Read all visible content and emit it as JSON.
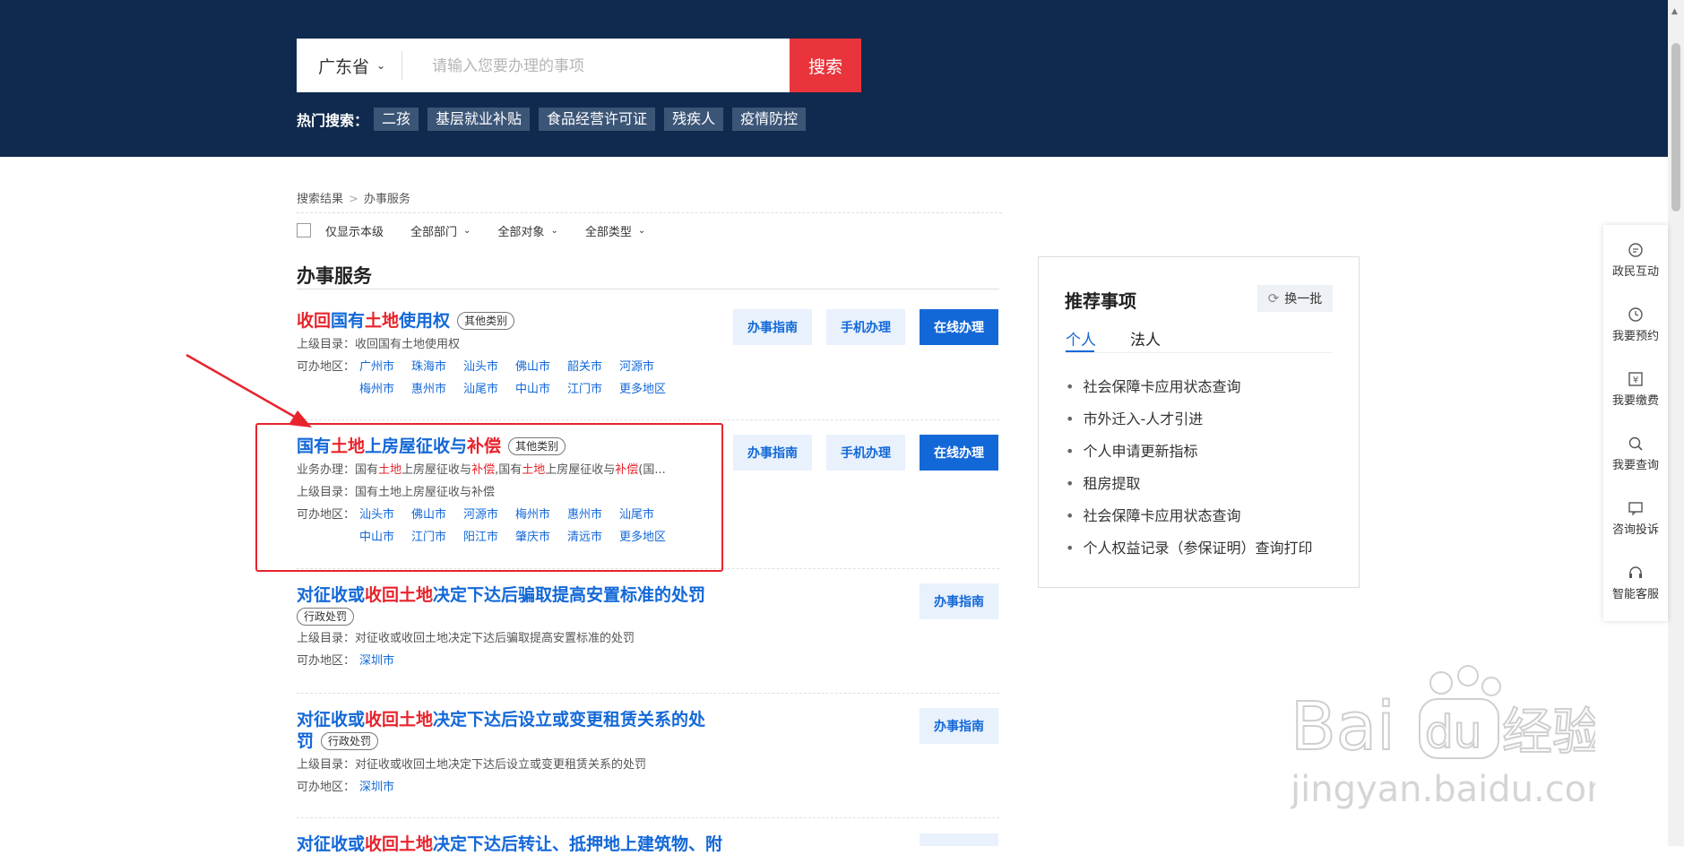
{
  "header": {
    "region": "广东省",
    "search_placeholder": "请输入您要办理的事项",
    "search_button": "搜索",
    "hot_label": "热门搜索：",
    "hot_tags": [
      "二孩",
      "基层就业补贴",
      "食品经营许可证",
      "残疾人",
      "疫情防控"
    ]
  },
  "breadcrumb": [
    "搜索结果",
    "办事服务"
  ],
  "breadcrumb_sep": ">",
  "filters": {
    "only_local": "仅显示本级",
    "department": "全部部门",
    "target": "全部对象",
    "type": "全部类型"
  },
  "section_title": "办事服务",
  "labels": {
    "parent": "上级目录：",
    "areas": "可办地区：",
    "business": "业务办理："
  },
  "buttons": {
    "guide": "办事指南",
    "mobile": "手机办理",
    "online": "在线办理"
  },
  "results": [
    {
      "title_parts": [
        {
          "t": "收回",
          "hl": true
        },
        {
          "t": "国有",
          "hl": false
        },
        {
          "t": "土地",
          "hl": true
        },
        {
          "t": "使用权",
          "hl": false
        }
      ],
      "badge": "其他类别",
      "parent": "收回国有土地使用权",
      "areas": [
        "广州市",
        "珠海市",
        "汕头市",
        "佛山市",
        "韶关市",
        "河源市",
        "梅州市",
        "惠州市",
        "汕尾市",
        "中山市",
        "江门市",
        "更多地区"
      ]
    },
    {
      "title_parts": [
        {
          "t": "国有",
          "hl": false
        },
        {
          "t": "土地",
          "hl": true
        },
        {
          "t": "上房屋征收与",
          "hl": false
        },
        {
          "t": "补偿",
          "hl": true
        }
      ],
      "badge": "其他类别",
      "business_parts": [
        {
          "t": "国有",
          "hl": false
        },
        {
          "t": "土地",
          "hl": true
        },
        {
          "t": "上房屋征收与",
          "hl": false
        },
        {
          "t": "补偿",
          "hl": true
        },
        {
          "t": ",国有",
          "hl": false
        },
        {
          "t": "土地",
          "hl": true
        },
        {
          "t": "上房屋征收与",
          "hl": false
        },
        {
          "t": "补偿",
          "hl": true
        },
        {
          "t": "(国...",
          "hl": false
        }
      ],
      "parent": "国有土地上房屋征收与补偿",
      "areas": [
        "汕头市",
        "佛山市",
        "河源市",
        "梅州市",
        "惠州市",
        "汕尾市",
        "中山市",
        "江门市",
        "阳江市",
        "肇庆市",
        "清远市",
        "更多地区"
      ]
    },
    {
      "title_parts": [
        {
          "t": "对征收或",
          "hl": false
        },
        {
          "t": "收回",
          "hl": true
        },
        {
          "t": "土地",
          "hl": true
        },
        {
          "t": "决定下达后骗取提高安置标准的处罚",
          "hl": false
        }
      ],
      "badge": "行政处罚",
      "parent": "对征收或收回土地决定下达后骗取提高安置标准的处罚",
      "areas": [
        "深圳市"
      ]
    },
    {
      "title_parts": [
        {
          "t": "对征收或",
          "hl": false
        },
        {
          "t": "收回",
          "hl": true
        },
        {
          "t": "土地",
          "hl": true
        },
        {
          "t": "决定下达后设立或变更租赁关系的处",
          "hl": false
        }
      ],
      "title_line2": "罚",
      "badge": "行政处罚",
      "parent": "对征收或收回土地决定下达后设立或变更租赁关系的处罚",
      "areas": [
        "深圳市"
      ]
    },
    {
      "title_parts": [
        {
          "t": "对征收或",
          "hl": false
        },
        {
          "t": "收回",
          "hl": true
        },
        {
          "t": "土地",
          "hl": true
        },
        {
          "t": "决定下达后转让、抵押地上建筑物、附",
          "hl": false
        }
      ]
    }
  ],
  "recommend": {
    "title": "推荐事项",
    "refresh": "换一批",
    "tabs": [
      "个人",
      "法人"
    ],
    "items": [
      "社会保障卡应用状态查询",
      "市外迁入-人才引进",
      "个人申请更新指标",
      "租房提取",
      "社会保障卡应用状态查询",
      "个人权益记录（参保证明）查询打印"
    ]
  },
  "sidebar": [
    "政民互动",
    "我要预约",
    "我要缴费",
    "我要查询",
    "咨询投诉",
    "智能客服"
  ],
  "watermark": {
    "brand": "Bai du 经验",
    "url": "jingyan.baidu.com"
  },
  "colors": {
    "header_bg": "#0f2a4e",
    "accent": "#1368d8",
    "highlight": "#e8232c",
    "search_button": "#e8343a"
  }
}
